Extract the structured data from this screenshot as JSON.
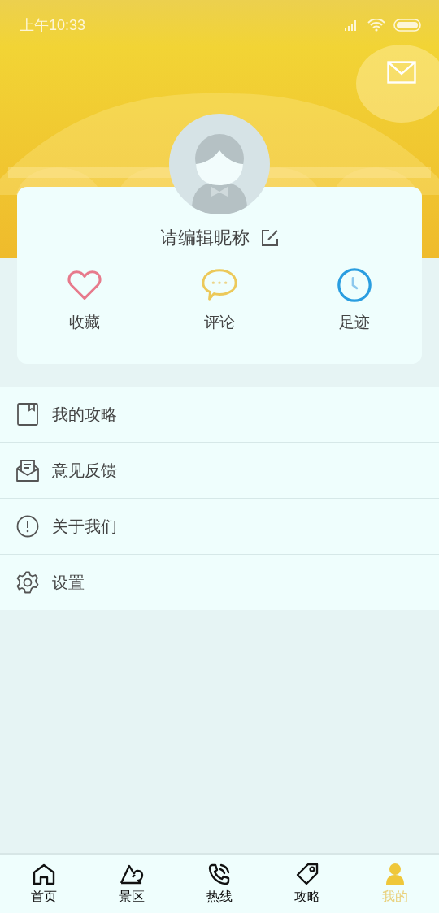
{
  "status_bar": {
    "time": "上午10:33"
  },
  "profile": {
    "nickname": "请编辑昵称"
  },
  "stats": [
    {
      "label": "收藏",
      "kind": "heart"
    },
    {
      "label": "评论",
      "kind": "comment"
    },
    {
      "label": "足迹",
      "kind": "clock"
    }
  ],
  "menu": [
    {
      "label": "我的攻略",
      "kind": "book"
    },
    {
      "label": "意见反馈",
      "kind": "mail"
    },
    {
      "label": "关于我们",
      "kind": "info"
    },
    {
      "label": "设置",
      "kind": "gear"
    }
  ],
  "tab_bar": [
    {
      "label": "首页",
      "kind": "home",
      "selected": false
    },
    {
      "label": "景区",
      "kind": "mountain",
      "selected": false
    },
    {
      "label": "热线",
      "kind": "phone",
      "selected": false
    },
    {
      "label": "攻略",
      "kind": "tag",
      "selected": false
    },
    {
      "label": "我的",
      "kind": "person",
      "selected": true
    }
  ]
}
